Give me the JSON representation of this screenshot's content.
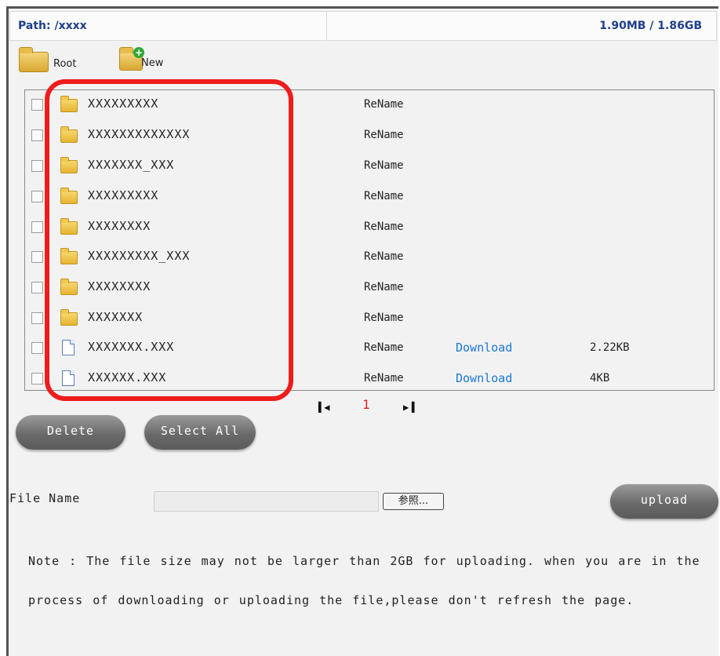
{
  "header": {
    "path": "Path: /xxxx",
    "usage": "1.90MB / 1.86GB"
  },
  "toolbar": {
    "root_label": "Root",
    "new_label": "New"
  },
  "files": [
    {
      "type": "folder",
      "name": "XXXXXXXXX",
      "rename": "ReName",
      "download": "",
      "size": ""
    },
    {
      "type": "folder",
      "name": "XXXXXXXXXXXXX",
      "rename": "ReName",
      "download": "",
      "size": ""
    },
    {
      "type": "folder",
      "name": "XXXXXXX_XXX",
      "rename": "ReName",
      "download": "",
      "size": ""
    },
    {
      "type": "folder",
      "name": "XXXXXXXXX",
      "rename": "ReName",
      "download": "",
      "size": ""
    },
    {
      "type": "folder",
      "name": "XXXXXXXX",
      "rename": "ReName",
      "download": "",
      "size": ""
    },
    {
      "type": "folder",
      "name": "XXXXXXXXX_XXX",
      "rename": "ReName",
      "download": "",
      "size": ""
    },
    {
      "type": "folder",
      "name": "XXXXXXXX",
      "rename": "ReName",
      "download": "",
      "size": ""
    },
    {
      "type": "folder",
      "name": "XXXXXXX",
      "rename": "ReName",
      "download": "",
      "size": ""
    },
    {
      "type": "file",
      "name": "XXXXXXX.XXX",
      "rename": "ReName",
      "download": "Download",
      "size": "2.22KB"
    },
    {
      "type": "file",
      "name": "XXXXXX.XXX",
      "rename": "ReName",
      "download": "Download",
      "size": "4KB"
    }
  ],
  "pager": {
    "current": "1"
  },
  "actions": {
    "delete_label": "Delete",
    "select_all_label": "Select All"
  },
  "upload": {
    "file_name_label": "File Name",
    "browse_label": "参照...",
    "upload_label": "upload",
    "file_value": ""
  },
  "note": {
    "line1": "Note : The file size may not be larger than 2GB for uploading. when you are in the",
    "line2": "process of downloading or uploading the file,please don't refresh the page."
  },
  "colors": {
    "link": "#1b77d6",
    "highlight": "#ef1c1c",
    "path_text": "#1f3f8a",
    "page_number": "#e02020"
  }
}
